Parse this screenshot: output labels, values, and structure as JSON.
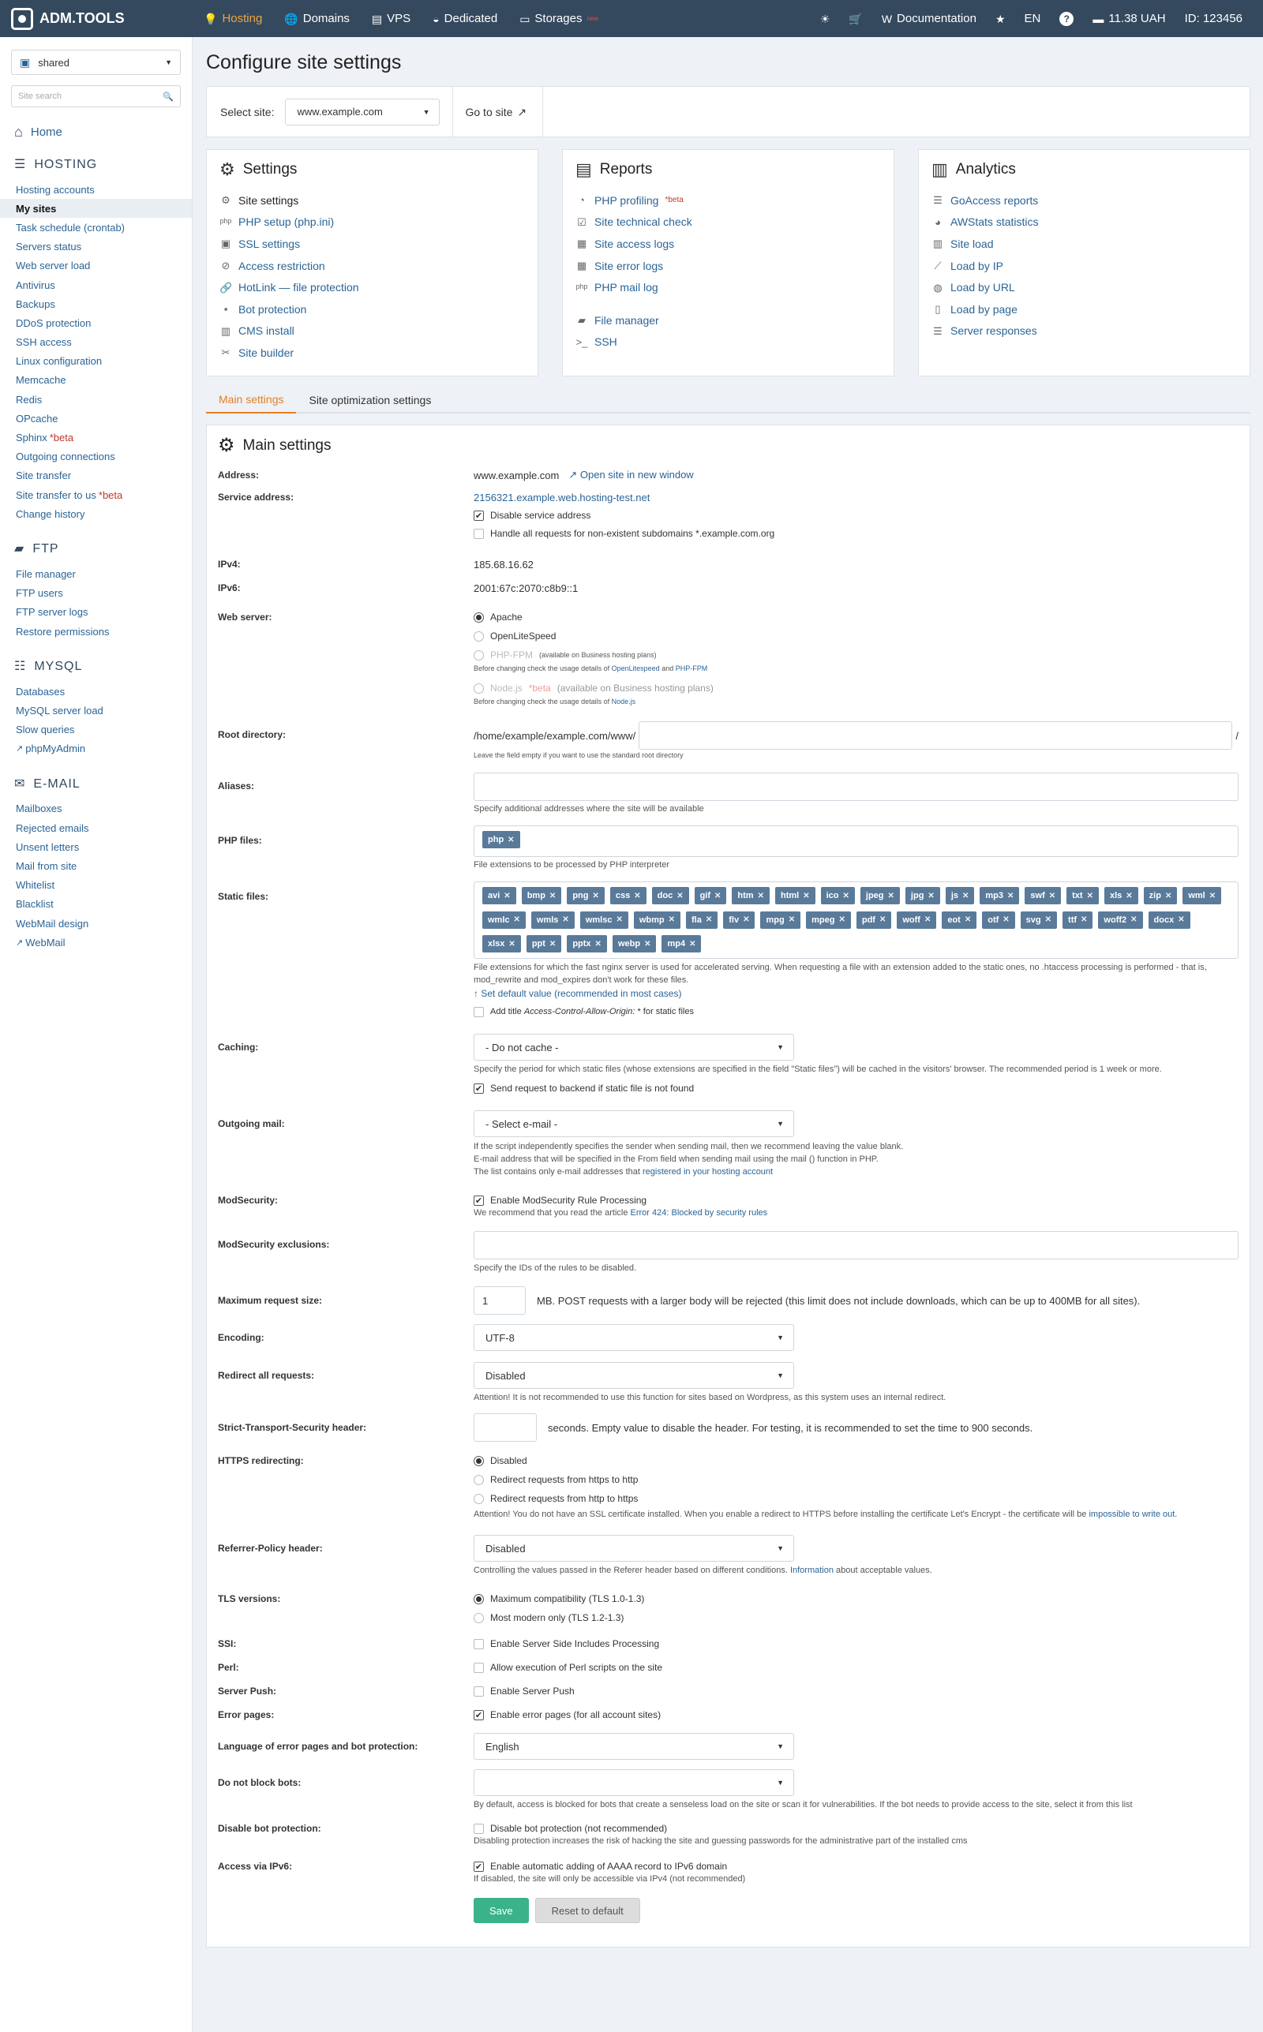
{
  "brand": "ADM.TOOLS",
  "topnav": [
    {
      "label": "Hosting",
      "icon": "lightbulb-icon",
      "active": true
    },
    {
      "label": "Domains",
      "icon": "globe-icon"
    },
    {
      "label": "VPS",
      "icon": "server-icon"
    },
    {
      "label": "Dedicated",
      "icon": "dedicated-icon"
    },
    {
      "label": "Storages",
      "icon": "storage-icon",
      "badge": "new"
    }
  ],
  "topright": {
    "documentation": "Documentation",
    "lang": "EN",
    "balance": "11.38 UAH",
    "id": "ID: 123456"
  },
  "sidebar": {
    "account": "shared",
    "search_placeholder": "Site search",
    "home": "Home",
    "hosting_title": "HOSTING",
    "hosting_items": [
      "Hosting accounts",
      "My sites",
      "Task schedule (crontab)",
      "Servers status",
      "Web server load",
      "Antivirus",
      "Backups",
      "DDoS protection",
      "SSH access",
      "Linux configuration",
      "Memcache",
      "Redis",
      "OPcache",
      "Sphinx",
      "Outgoing connections",
      "Site transfer",
      "Site transfer to us",
      "Change history"
    ],
    "beta": "*beta",
    "ftp_title": "FTP",
    "ftp_items": [
      "File manager",
      "FTP users",
      "FTP server logs",
      "Restore permissions"
    ],
    "mysql_title": "MYSQL",
    "mysql_items": [
      "Databases",
      "MySQL server load",
      "Slow queries",
      "phpMyAdmin"
    ],
    "email_title": "E-MAIL",
    "email_items": [
      "Mailboxes",
      "Rejected emails",
      "Unsent letters",
      "Mail from site",
      "Whitelist",
      "Blacklist",
      "WebMail design",
      "WebMail"
    ]
  },
  "page": {
    "title": "Configure site settings",
    "select_site_label": "Select site:",
    "select_site_value": "www.example.com",
    "goto_site": "Go to site"
  },
  "cards": {
    "settings": {
      "title": "Settings",
      "items": [
        "Site settings",
        "PHP setup (php.ini)",
        "SSL settings",
        "Access restriction",
        "HotLink — file protection",
        "Bot protection",
        "CMS install",
        "Site builder"
      ]
    },
    "reports": {
      "title": "Reports",
      "items": [
        "PHP profiling",
        "Site technical check",
        "Site access logs",
        "Site error logs",
        "PHP mail log"
      ],
      "extra": [
        "File manager",
        "SSH"
      ],
      "beta": "*beta"
    },
    "analytics": {
      "title": "Analytics",
      "items": [
        "GoAccess reports",
        "AWStats statistics",
        "Site load",
        "Load by IP",
        "Load by URL",
        "Load by page",
        "Server responses"
      ]
    }
  },
  "tabs": [
    "Main settings",
    "Site optimization settings"
  ],
  "main": {
    "title": "Main settings",
    "address_label": "Address:",
    "address_value": "www.example.com",
    "open_new_window": "Open site in new window",
    "service_label": "Service address:",
    "service_value": "2156321.example.web.hosting-test.net",
    "disable_service": "Disable service address",
    "handle_subdomains": "Handle all requests for non-existent subdomains *.example.com.org",
    "ipv4_label": "IPv4:",
    "ipv4_value": "185.68.16.62",
    "ipv6_label": "IPv6:",
    "ipv6_value": "2001:67c:2070:c8b9::1",
    "webserver_label": "Web server:",
    "ws_apache": "Apache",
    "ws_ols": "OpenLiteSpeed",
    "ws_phpfpm": "PHP-FPM",
    "ws_phpfpm_note": "(available on Business hosting plans)",
    "ws_phpfpm_hint_a": "Before changing check the usage details of",
    "ws_phpfpm_hint_ols": "OpenLitespeed",
    "ws_and": "and",
    "ws_phpfpm_hint_fpm": "PHP-FPM",
    "ws_node": "Node.js",
    "ws_node_beta": "*beta",
    "ws_node_note": "(available on Business hosting plans)",
    "ws_node_hint": "Before changing check the usage details of",
    "ws_node_link": "Node.js",
    "root_label": "Root directory:",
    "root_prefix": "/home/example/example.com/www/",
    "root_suffix": "/",
    "root_hint": "Leave the field empty if you want to use the standard root directory",
    "aliases_label": "Aliases:",
    "aliases_hint": "Specify additional addresses where the site will be available",
    "php_label": "PHP files:",
    "php_tags": [
      "php"
    ],
    "php_hint": "File extensions to be processed by PHP interpreter",
    "static_label": "Static files:",
    "static_tags": [
      "avi",
      "bmp",
      "png",
      "css",
      "doc",
      "gif",
      "htm",
      "html",
      "ico",
      "jpeg",
      "jpg",
      "js",
      "mp3",
      "swf",
      "txt",
      "xls",
      "zip",
      "wml",
      "wmlc",
      "wmls",
      "wmlsc",
      "wbmp",
      "fla",
      "flv",
      "mpg",
      "mpeg",
      "pdf",
      "woff",
      "eot",
      "otf",
      "svg",
      "ttf",
      "woff2",
      "docx",
      "xlsx",
      "ppt",
      "pptx",
      "webp",
      "mp4"
    ],
    "static_hint": "File extensions for which the fast nginx server is used for accelerated serving. When requesting a file with an extension added to the static ones, no .htaccess processing is performed - that is, mod_rewrite and mod_expires don't work for these files.",
    "set_default": "↑ Set default value (recommended in most cases)",
    "cors_label_a": "Add title",
    "cors_label_b": "Access-Control-Allow-Origin:",
    "cors_label_c": "* for static files",
    "caching_label": "Caching:",
    "caching_value": "- Do not cache -",
    "caching_hint": "Specify the period for which static files (whose extensions are specified in the field \"Static files\") will be cached in the visitors' browser. The recommended period is 1 week or more.",
    "send_backend": "Send request to backend if static file is not found",
    "mail_label": "Outgoing mail:",
    "mail_value": "- Select e-mail -",
    "mail_hint1": "If the script independently specifies the sender when sending mail, then we recommend leaving the value blank.",
    "mail_hint2": "E-mail address that will be specified in the From field when sending mail using the mail () function in PHP.",
    "mail_hint3a": "The list contains only e-mail addresses that",
    "mail_hint3b": "registered in your hosting account",
    "modsec_label": "ModSecurity:",
    "modsec_cb": "Enable ModSecurity Rule Processing",
    "modsec_hint_a": "We recommend that you read the article",
    "modsec_hint_b": "Error 424: Blocked by security rules",
    "modsec_ex_label": "ModSecurity exclusions:",
    "modsec_ex_hint": "Specify the IDs of the rules to be disabled.",
    "maxreq_label": "Maximum request size:",
    "maxreq_value": "1",
    "maxreq_hint": "MB. POST requests with a larger body will be rejected (this limit does not include downloads, which can be up to 400MB for all sites).",
    "enc_label": "Encoding:",
    "enc_value": "UTF-8",
    "redirect_label": "Redirect all requests:",
    "redirect_value": "Disabled",
    "redirect_hint": "Attention! It is not recommended to use this function for sites based on Wordpress, as this system uses an internal redirect.",
    "hsts_label": "Strict-Transport-Security header:",
    "hsts_hint": "seconds. Empty value to disable the header. For testing, it is recommended to set the time to 900 seconds.",
    "https_label": "HTTPS redirecting:",
    "https_disabled": "Disabled",
    "https_to_http": "Redirect requests from https to http",
    "http_to_https": "Redirect requests from http to https",
    "https_hint_a": "Attention! You do not have an SSL certificate installed. When you enable a redirect to HTTPS before installing the certificate Let's Encrypt - the certificate will be",
    "https_hint_b": "impossible to write out.",
    "referrer_label": "Referrer-Policy header:",
    "referrer_value": "Disabled",
    "referrer_hint_a": "Controlling the values passed in the Referer header based on different conditions.",
    "referrer_hint_b": "Information",
    "referrer_hint_c": "about acceptable values.",
    "tls_label": "TLS versions:",
    "tls_max": "Maximum compatibility (TLS 1.0-1.3)",
    "tls_modern": "Most modern only (TLS 1.2-1.3)",
    "ssi_label": "SSI:",
    "ssi_cb": "Enable Server Side Includes Processing",
    "perl_label": "Perl:",
    "perl_cb": "Allow execution of Perl scripts on the site",
    "push_label": "Server Push:",
    "push_cb": "Enable Server Push",
    "err_label": "Error pages:",
    "err_cb": "Enable error pages (for all account sites)",
    "lang_label": "Language of error pages and bot protection:",
    "lang_value": "English",
    "bots_label": "Do not block bots:",
    "bots_hint": "By default, access is blocked for bots that create a senseless load on the site or scan it for vulnerabilities. If the bot needs to provide access to the site, select it from this list",
    "botprot_label": "Disable bot protection:",
    "botprot_cb": "Disable bot protection (not recommended)",
    "botprot_hint": "Disabling protection increases the risk of hacking the site and guessing passwords for the administrative part of the installed cms",
    "ipv6acc_label": "Access via IPv6:",
    "ipv6acc_cb": "Enable automatic adding of AAAA record to IPv6 domain",
    "ipv6acc_hint": "If disabled, the site will only be accessible via IPv4 (not recommended)",
    "save": "Save",
    "reset": "Reset to default"
  }
}
